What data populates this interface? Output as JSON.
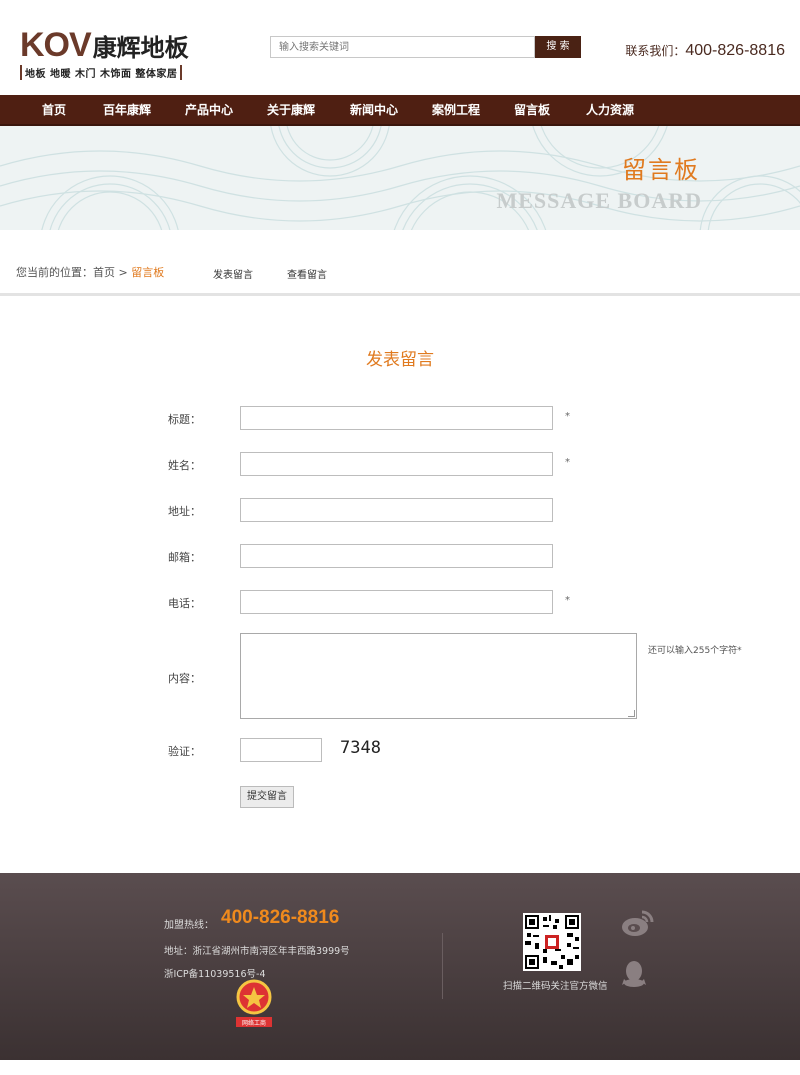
{
  "header": {
    "logo_brand": "KOV",
    "logo_name": "康辉地板",
    "logo_tagline": "地板 地暖 木门 木饰面 整体家居",
    "search_placeholder": "输入搜索关键词",
    "search_button": "搜 索",
    "contact_label": "联系我们：",
    "contact_phone": "400-826-8816"
  },
  "nav": {
    "items": [
      "首页",
      "百年康辉",
      "产品中心",
      "关于康辉",
      "新闻中心",
      "案例工程",
      "留言板",
      "人力资源"
    ]
  },
  "banner": {
    "title_cn": "留言板",
    "title_en": "MESSAGE BOARD"
  },
  "breadcrumb": {
    "prefix": "您当前的位置：",
    "home": "首页",
    "separator": " > ",
    "current": "留言板",
    "links": [
      "发表留言",
      "查看留言"
    ]
  },
  "form": {
    "title": "发表留言",
    "fields": [
      {
        "label": "标题：",
        "required": "*"
      },
      {
        "label": "姓名：",
        "required": "*"
      },
      {
        "label": "地址：",
        "required": ""
      },
      {
        "label": "邮箱：",
        "required": ""
      },
      {
        "label": "电话：",
        "required": "*"
      }
    ],
    "content_label": "内容：",
    "content_hint": "还可以输入255个字符*",
    "captcha_label": "验证：",
    "captcha_code": "7348",
    "submit_label": "提交留言"
  },
  "footer": {
    "hotline_label": "加盟热线：",
    "hotline": "400-826-8816",
    "address": "地址：浙江省湖州市南浔区年丰西路3999号",
    "icp": "浙ICP备11039516号-4",
    "badge_text": "网络工商",
    "scan_text": "扫描二维码关注官方微信"
  },
  "colors": {
    "brand_brown": "#4f1f12",
    "accent_orange": "#e07a1f",
    "footer_bg": "#4a3e40"
  }
}
